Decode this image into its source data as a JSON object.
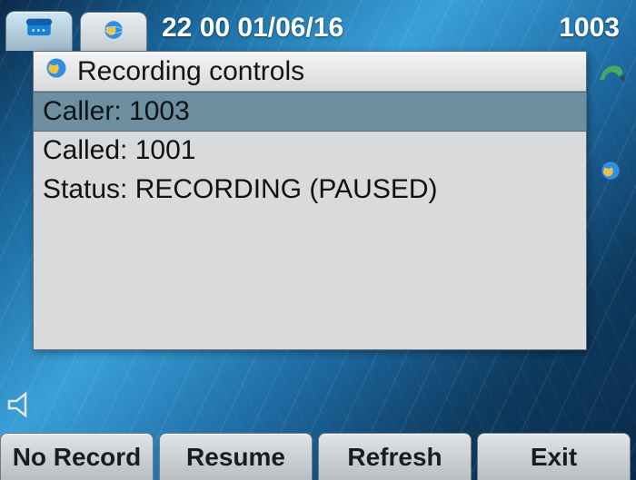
{
  "topbar": {
    "datetime": "22 00 01/06/16",
    "extension": "1003"
  },
  "window": {
    "title": "Recording controls",
    "rows": {
      "caller": "Caller: 1003",
      "called": "Called: 1001",
      "status": "Status: RECORDING (PAUSED)"
    }
  },
  "softkeys": {
    "k1": "No Record",
    "k2": "Resume",
    "k3": "Refresh",
    "k4": "Exit"
  }
}
